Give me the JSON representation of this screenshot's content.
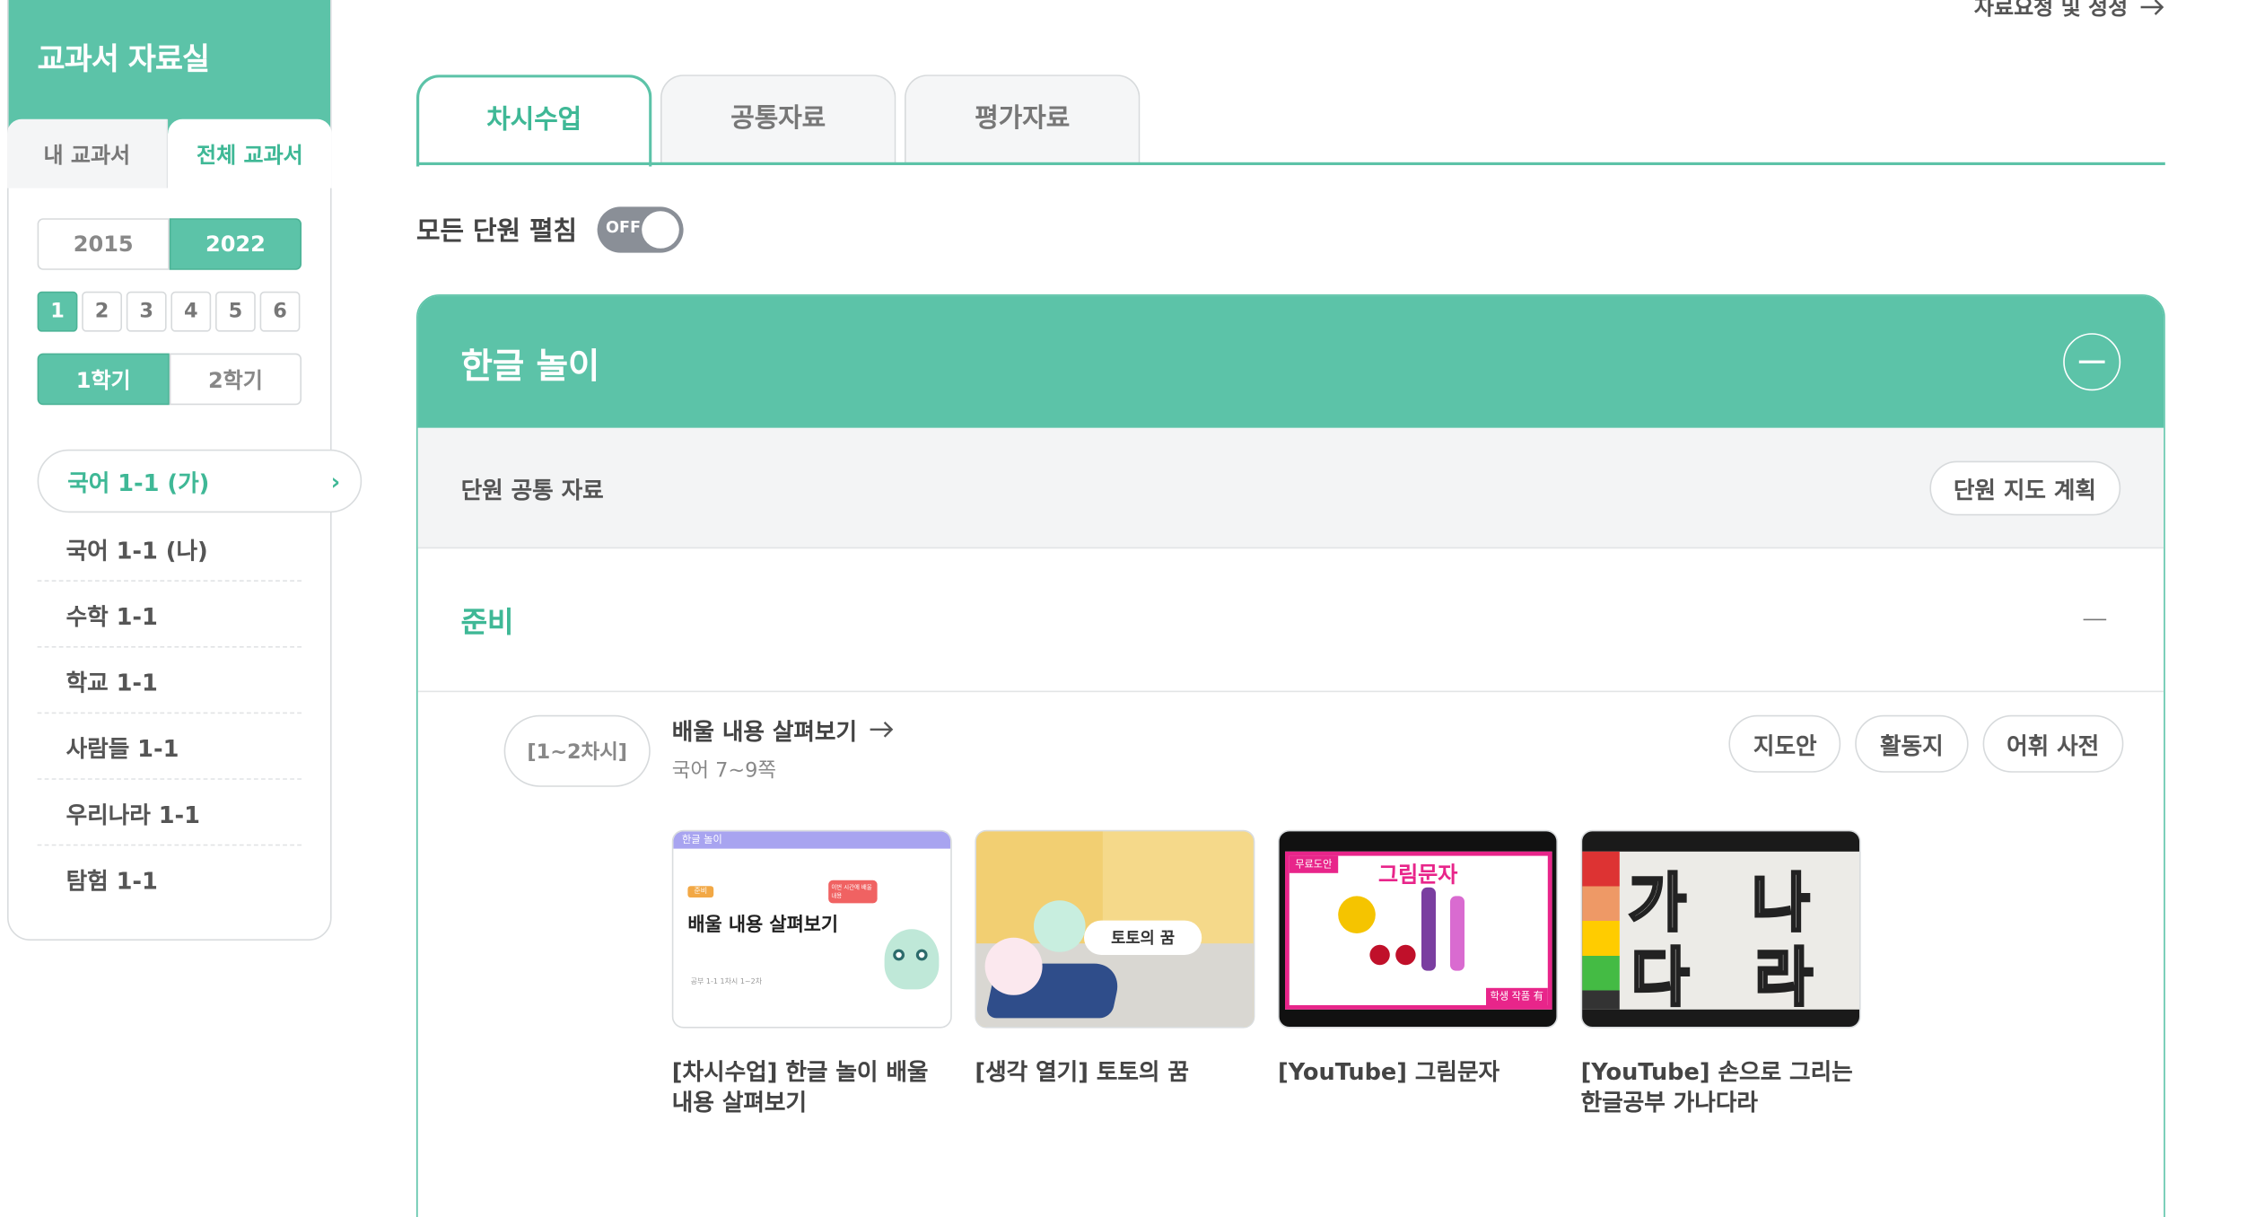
{
  "top_link": {
    "label": "자료요청 및 정정",
    "icon": "arrow-right-icon"
  },
  "sidebar": {
    "title": "교과서 자료실",
    "tabs": [
      {
        "label": "내 교과서",
        "active": false
      },
      {
        "label": "전체 교과서",
        "active": true
      }
    ],
    "years": [
      {
        "label": "2015",
        "active": false
      },
      {
        "label": "2022",
        "active": true
      }
    ],
    "grades": [
      {
        "label": "1",
        "active": true
      },
      {
        "label": "2",
        "active": false
      },
      {
        "label": "3",
        "active": false
      },
      {
        "label": "4",
        "active": false
      },
      {
        "label": "5",
        "active": false
      },
      {
        "label": "6",
        "active": false
      }
    ],
    "semesters": [
      {
        "label": "1학기",
        "active": true
      },
      {
        "label": "2학기",
        "active": false
      }
    ],
    "books": [
      {
        "label": "국어 1-1 (가)",
        "active": true
      },
      {
        "label": "국어 1-1 (나)",
        "active": false
      },
      {
        "label": "수학 1-1",
        "active": false
      },
      {
        "label": "학교 1-1",
        "active": false
      },
      {
        "label": "사람들 1-1",
        "active": false
      },
      {
        "label": "우리나라 1-1",
        "active": false
      },
      {
        "label": "탐험 1-1",
        "active": false
      }
    ]
  },
  "main_tabs": [
    {
      "label": "차시수업",
      "active": true
    },
    {
      "label": "공통자료",
      "active": false
    },
    {
      "label": "평가자료",
      "active": false
    }
  ],
  "expand_all": {
    "label": "모든 단원 펼침",
    "state": "OFF"
  },
  "unit": {
    "title": "한글 놀이",
    "common_label": "단원 공통 자료",
    "plan_button": "단원 지도 계획",
    "section_label": "준비",
    "lesson": {
      "period": "[1~2차시]",
      "title": "배울 내용 살펴보기",
      "pages": "국어 7~9쪽",
      "buttons": [
        "지도안",
        "활동지",
        "어휘 사전"
      ]
    },
    "cards": [
      {
        "caption": "[차시수업] 한글 놀이 배울 내용 살펴보기",
        "thumb": {
          "bar": "한글 놀이",
          "tag": "준비",
          "heading": "배울 내용 살펴보기",
          "note": "이번 시간에 배울 내용",
          "footer": "공부 1-1 1차시  1~2차"
        }
      },
      {
        "caption": "[생각 열기] 토토의 꿈",
        "thumb": {
          "bubble": "토토의 꿈"
        }
      },
      {
        "caption": "[YouTube] 그림문자",
        "thumb": {
          "tag": "무료도안",
          "title": "그림문자",
          "badge": "학생 작품 有"
        }
      },
      {
        "caption": "[YouTube] 손으로 그리는 한글공부 가나다라",
        "thumb": {
          "glyphs": [
            "가",
            "나",
            "다",
            "라"
          ]
        }
      }
    ]
  },
  "colors": {
    "accent": "#5cc3a8",
    "accent_text": "#3fb896",
    "toggle_off": "#8a8f97"
  }
}
